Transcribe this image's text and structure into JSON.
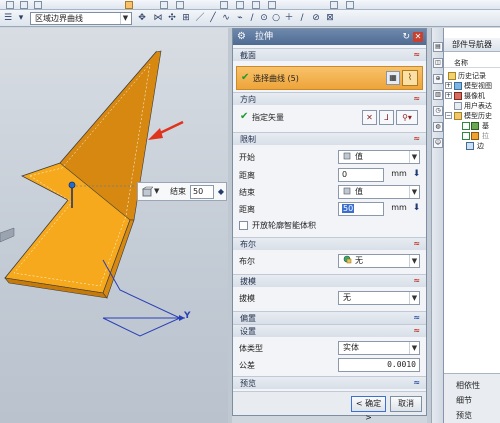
{
  "toolbar2": {
    "filter_value": "区域边界曲线"
  },
  "dialog": {
    "title": "拉伸",
    "sections": {
      "section": "截面",
      "direction": "方向",
      "limits": "限制",
      "boolean": "布尔",
      "draft": "拔模",
      "offset": "偏置",
      "settings": "设置",
      "preview": "预览"
    },
    "select_curve": "选择曲线 (5)",
    "specify_vector": "指定矢量",
    "limits": {
      "start_label": "开始",
      "start_type": "值",
      "start_distance_label": "距离",
      "start_distance": "0",
      "end_label": "结束",
      "end_type": "值",
      "end_distance_label": "距离",
      "end_distance": "50",
      "unit": "mm",
      "open_profile_label": "开放轮廓智能体积"
    },
    "boolean": {
      "label": "布尔",
      "value": "无"
    },
    "draft": {
      "label": "拔模",
      "value": "无"
    },
    "settings": {
      "body_type_label": "体类型",
      "body_type": "实体",
      "tolerance_label": "公差",
      "tolerance": "0.0010"
    },
    "ok_label": "< 确定 >",
    "cancel_label": "取消"
  },
  "viewport": {
    "end_label": "结束",
    "end_value": "50",
    "axis_y": "Y"
  },
  "navigator": {
    "title": "部件导航器",
    "column_name": "名称",
    "tree": [
      "历史记录",
      "模型视图",
      "摄像机",
      "用户表达",
      "模型历史",
      "基",
      "拉",
      "边"
    ],
    "bottom_tabs": [
      "相依性",
      "细节",
      "预览"
    ]
  },
  "colors": {
    "accent_orange": "#f5a623",
    "title_blue": "#5a76a0",
    "check_green": "#1e9a2e"
  }
}
